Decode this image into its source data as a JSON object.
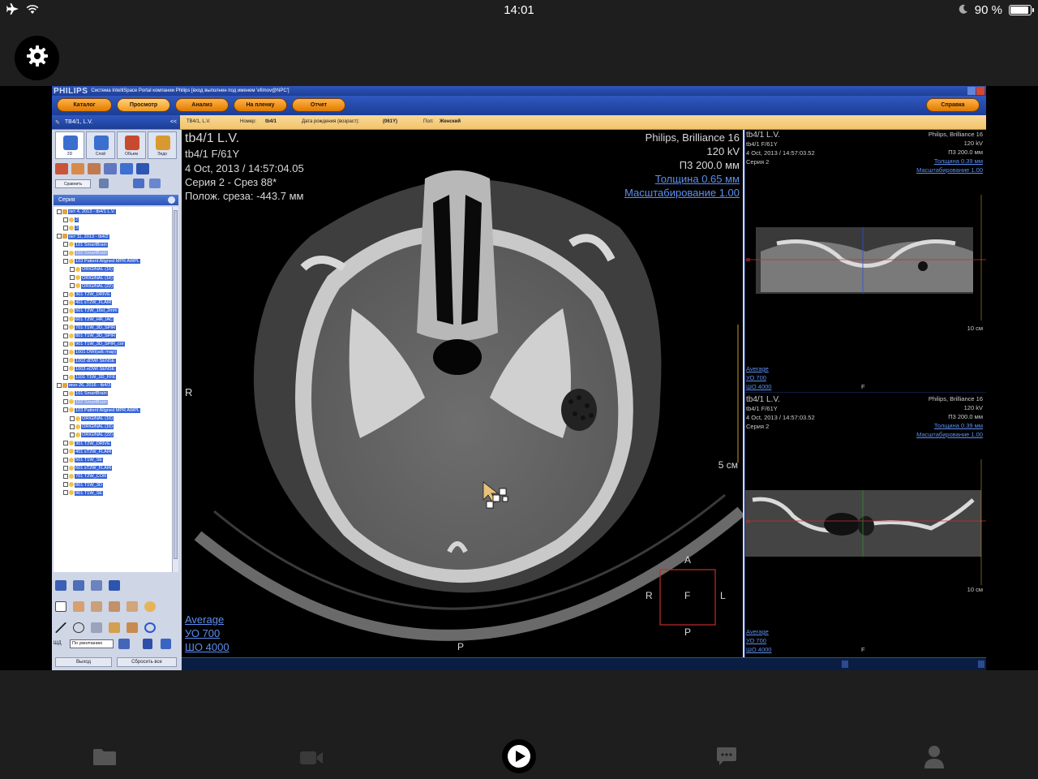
{
  "status_bar": {
    "time": "14:01",
    "battery_text": "90 %",
    "battery_level": 0.9
  },
  "app": {
    "brand": "PHILIPS",
    "window_title": "Система IntelliSpace Portal компании Philips [вход выполнен под именем 'efimov@NPC']",
    "menu": [
      {
        "label": "Каталог",
        "active": false
      },
      {
        "label": "Просмотр",
        "active": true
      },
      {
        "label": "Анализ",
        "active": false
      },
      {
        "label": "На пленку",
        "active": false
      },
      {
        "label": "Отчет",
        "active": false
      }
    ],
    "help_label": "Справка",
    "patient_tab": "ТВ4/1, L.V.",
    "collapse": "<<",
    "info": {
      "name": "ТВ4/1, L.V.",
      "number_label": "Номер:",
      "number_value": "tb4/1",
      "dob_label": "Дата рождения (возраст):",
      "dob_value": "(061Y)",
      "sex_label": "Пол:",
      "sex_value": "Женский"
    },
    "tool_tabs": [
      {
        "label": "2D",
        "color": "#3a6fd0"
      },
      {
        "label": "Слой",
        "color": "#3a6fd0"
      },
      {
        "label": "Объем",
        "color": "#c84a2e"
      },
      {
        "label": "Эндо",
        "color": "#d89a30"
      }
    ],
    "compare_label": "Сравнить",
    "series_header": "Серия",
    "series_tree": [
      {
        "indent": 0,
        "text": "окт 4, 2013 - tb4/1 L.V.",
        "dim": false
      },
      {
        "indent": 1,
        "text": "2",
        "dim": false
      },
      {
        "indent": 1,
        "text": "3",
        "dim": false
      },
      {
        "indent": 0,
        "text": "окт 11, 2013 - tb4/2",
        "dim": false
      },
      {
        "indent": 1,
        "text": "101  SmartBrain",
        "dim": false
      },
      {
        "indent": 1,
        "text": "102  SmartBrain",
        "dim": true
      },
      {
        "indent": 1,
        "text": "103  Patient Aligned MPR AWPL",
        "dim": false
      },
      {
        "indent": 2,
        "text": "ORIGINAL (16)",
        "dim": false
      },
      {
        "indent": 2,
        "text": "ORIGINAL (16)",
        "dim": false
      },
      {
        "indent": 2,
        "text": "ORIGINAL (22)",
        "dim": false
      },
      {
        "indent": 1,
        "text": "301  T2W_DRIVE",
        "dim": false
      },
      {
        "indent": 1,
        "text": "401  sT2W_FLAIR",
        "dim": false
      },
      {
        "indent": 1,
        "text": "501  T2W_16sl_2mm",
        "dim": false
      },
      {
        "indent": 1,
        "text": "601  T2W_HR_IAC",
        "dim": false
      },
      {
        "indent": 1,
        "text": "701  T1W_3D_SPIR",
        "dim": false
      },
      {
        "indent": 1,
        "text": "801  T1W_3D_SPIR",
        "dim": false
      },
      {
        "indent": 1,
        "text": "901  T1W_3D_SPIR_cor",
        "dim": false
      },
      {
        "indent": 1,
        "text": "1001  DWI(adc map)",
        "dim": false
      },
      {
        "indent": 1,
        "text": "1002  dDWI SENSE",
        "dim": false
      },
      {
        "indent": 1,
        "text": "1003  eDWI SENSE",
        "dim": false
      },
      {
        "indent": 1,
        "text": "1101  T1W_3D_FFE",
        "dim": false
      },
      {
        "indent": 0,
        "text": "июн 26, 2016 - tb4/3",
        "dim": false
      },
      {
        "indent": 1,
        "text": "101  SmartBrain",
        "dim": false
      },
      {
        "indent": 1,
        "text": "102  SmartBrain",
        "dim": true
      },
      {
        "indent": 1,
        "text": "103  Patient Aligned MPR AWPL",
        "dim": false
      },
      {
        "indent": 2,
        "text": "ORIGINAL (16)",
        "dim": false
      },
      {
        "indent": 2,
        "text": "ORIGINAL (16)",
        "dim": false
      },
      {
        "indent": 2,
        "text": "ORIGINAL (22)",
        "dim": false
      },
      {
        "indent": 1,
        "text": "301  T2W_DRIVE",
        "dim": false
      },
      {
        "indent": 1,
        "text": "401  sT2W_FLAIR",
        "dim": false
      },
      {
        "indent": 1,
        "text": "501  T1W_SE",
        "dim": false
      },
      {
        "indent": 1,
        "text": "601  sT2W_FLAIR",
        "dim": false
      },
      {
        "indent": 1,
        "text": "701  T2W_COR",
        "dim": false
      },
      {
        "indent": 1,
        "text": "801  T1W_3D",
        "dim": false
      },
      {
        "indent": 1,
        "text": "901  T1W_SE",
        "dim": false
      }
    ],
    "wd_label": "ШД",
    "wd_preset": "По умолчанию",
    "exit_label": "Выход",
    "reset_label": "Сбросить все"
  },
  "main_view": {
    "patient": "tb4/1 L.V.",
    "patient_id": "tb4/1 F/61Y",
    "date": "4 Oct, 2013 / 14:57:04.05",
    "series": "Серия 2 - Срез 88*",
    "slice_pos": "Полож. среза: -443.7 мм",
    "scanner": "Philips, Brilliance 16",
    "kv": "120 kV",
    "fov": "П3 200.0 мм",
    "thickness": "Толщина 0.65 мм",
    "zoom": "Масштабирование 1.00",
    "window_preset": "Average",
    "wl": "УО   700",
    "ww": "ШО  4000",
    "orient_left": "R",
    "orient_bottom": "P",
    "scale_label": "5 см",
    "cube": {
      "top": "A",
      "left": "R",
      "center": "F",
      "right": "L",
      "bottom": "P"
    }
  },
  "right_view": {
    "top": {
      "patient": "tb4/1 L.V.",
      "patient_id": "tb4/1 F/61Y",
      "date": "4 Oct, 2013 / 14:57:03.52",
      "series": "Серия 2",
      "scanner": "Philips, Brilliance 16",
      "kv": "120 kV",
      "fov": "П3 200.0 мм",
      "thickness": "Толщина 0.39 мм",
      "zoom": "Масштабирование 1.00",
      "orient_left": "R",
      "scale_label": "10 см",
      "window_preset": "Average",
      "wl": "УО   700",
      "ww": "ШО  4000",
      "orient_bottom": "F"
    },
    "bottom": {
      "patient": "tb4/1 L.V.",
      "patient_id": "tb4/1 F/61Y",
      "date": "4 Oct, 2013 / 14:57:03.52",
      "series": "Серия 2",
      "scanner": "Philips, Brilliance 16",
      "kv": "120 kV",
      "fov": "П3 200.0 мм",
      "thickness": "Толщина 0.39 мм",
      "zoom": "Масштабирование 1.00",
      "orient_left": "A",
      "scale_label": "10 см",
      "window_preset": "Average",
      "wl": "УО   700",
      "ww": "ШО  4000",
      "orient_bottom": "F"
    }
  },
  "icons": {
    "settings": "gear-icon",
    "tabs": [
      "folder-icon",
      "video-camera-icon",
      "play-icon",
      "chat-icon",
      "person-icon"
    ]
  }
}
